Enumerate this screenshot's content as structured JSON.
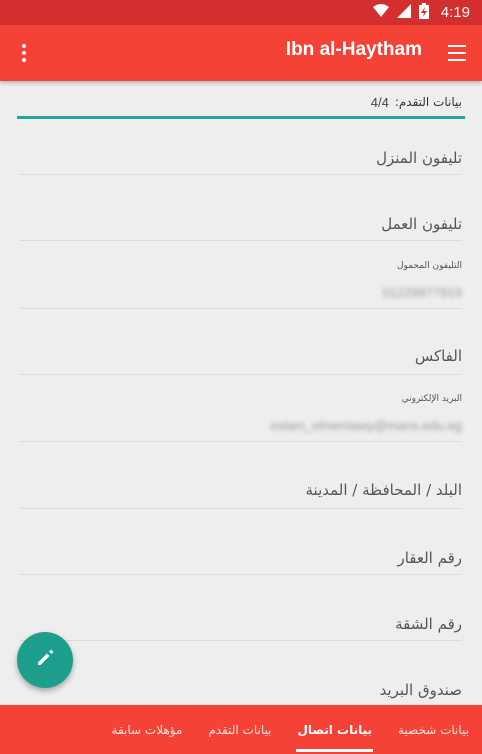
{
  "status_bar": {
    "time": "4:19"
  },
  "app_bar": {
    "title": "Ibn al-Haytham"
  },
  "progress": {
    "label": "بيانات التقدم:",
    "value": "4/4"
  },
  "fields": {
    "home_phone": {
      "placeholder": "تليفون المنزل"
    },
    "work_phone": {
      "placeholder": "تليفون العمل"
    },
    "mobile_phone": {
      "label": "التليفون المحمول",
      "value": "01229977919"
    },
    "fax": {
      "placeholder": "الفاكس"
    },
    "email": {
      "label": "البريد الإلكتروني",
      "value": "eslam_elmeniawy@mans.edu.eg"
    },
    "country_city": {
      "placeholder": "البلد / المحافظة / المدينة"
    },
    "property_number": {
      "placeholder": "رقم العقار"
    },
    "apartment_number": {
      "placeholder": "رقم الشقة"
    },
    "po_box": {
      "placeholder": "صندوق البريد"
    }
  },
  "tabs": [
    {
      "label": "بيانات شخصية"
    },
    {
      "label": "بيانات اتصال"
    },
    {
      "label": "بيانات التقدم"
    },
    {
      "label": "مؤهلات سابقة"
    }
  ],
  "active_tab_index": 1,
  "colors": {
    "primary": "#f44336",
    "primary_dark": "#d32f2f",
    "accent": "#26a69a"
  }
}
